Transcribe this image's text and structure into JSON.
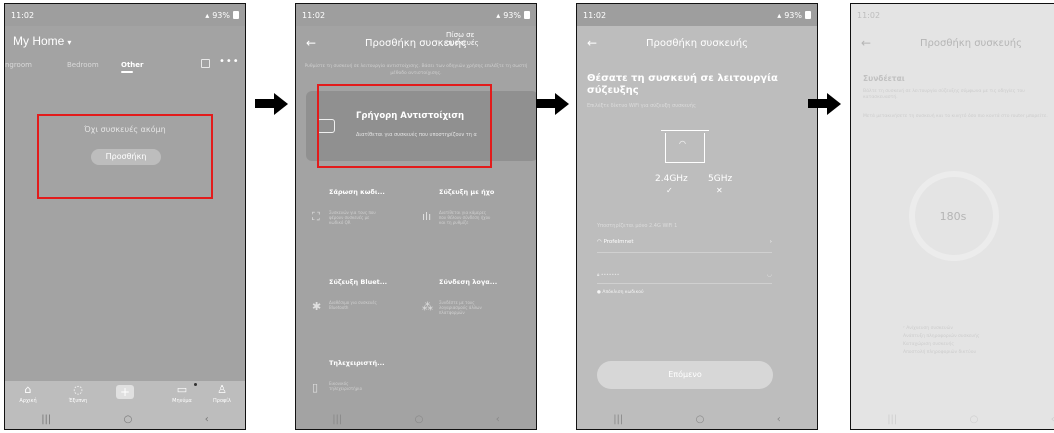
{
  "colors": {
    "highlight": "#e31b1b",
    "arrow": "#000000"
  },
  "status": {
    "time": "11:02",
    "battery": "93%"
  },
  "screen1": {
    "title": "My Home",
    "tabs": [
      "ingroom",
      "Bedroom",
      "Other"
    ],
    "empty_text": "Όχι συσκευές ακόμη",
    "add_button": "Προσθήκη",
    "nav": [
      {
        "label": "Αρχική",
        "icon": "home-icon"
      },
      {
        "label": "Έξυπνη",
        "icon": "smart-icon"
      },
      {
        "label": "Μηνύμα",
        "icon": "message-icon"
      },
      {
        "label": "Προφίλ",
        "icon": "profile-icon"
      }
    ]
  },
  "screen2": {
    "header": "Προσθήκη συσκευής",
    "header_overlap": "Πίσω σε συσκευές",
    "instruction": "Ρυθμίστε τη συσκευή σε λειτουργία αντιστοίχισης. Βάσει των οδηγιών χρήσης επιλέξτε τη σωστή μέθοδο αντιστοίχισης.",
    "quick_match": {
      "title": "Γρήγορη Αντιστοίχιση",
      "subtitle": "Διατίθεται για συσκευές που υποστηρίζουν τη α"
    },
    "options": [
      {
        "title": "Σάρωση κωδι...",
        "desc": "Συσκευών για τους που φέρουν συσκευές με κωδικό QR"
      },
      {
        "title": "Σύζευξη με ήχο",
        "desc": "Διατίθεται για κάμερες που θέλουν σύνδεση ήχου και τη ρυθμίζε"
      },
      {
        "title": "Σύζευξη Bluet...",
        "desc": "Διαθέσιμο για συσκευές Bluetooth"
      },
      {
        "title": "Σύνδεση λογα...",
        "desc": "Συνδέστε με τους λογαριασμούς άλλων πλατφορμών"
      },
      {
        "title": "Τηλεχειριστή...",
        "desc": "Εικονικός τηλεχειριστήριο"
      }
    ]
  },
  "screen3": {
    "header": "Προσθήκη συσκευής",
    "title": "Θέσατε τη συσκευή σε λειτουργία σύζευξης",
    "subtitle": "Επιλέξτε δίκτυο WiFi για σύζευξη συσκευής",
    "band1": "2.4GHz",
    "band2": "5GHz",
    "note": "Υποστηρίζεται μόνο 2.4G WiFi 1",
    "wifi_name": "Profelmnet",
    "password_placeholder": "•••••••",
    "forgot": "Απόκλιση κωδικού",
    "next_button": "Επόμενο"
  },
  "screen4": {
    "header": "Προσθήκη συσκευής",
    "connecting": "Συνδέεται",
    "para1": "Βάλτε τη συσκευή σε λειτουργία σύζευξης σύμφωνα με τις οδηγίες του κατασκευαστή.",
    "para2": "Μετά μετακινήσετε τη συσκευή και το κινητό όσο πιο κοντά στο router μπορείτε.",
    "timer": "180s",
    "steps": [
      "Ανίχνευση συσκευών",
      "Ανάπτυξη πληροφοριών συσκευής",
      "Καταχώριση συσκευής",
      "Αποστολή πληροφοριών δικτύου"
    ]
  }
}
